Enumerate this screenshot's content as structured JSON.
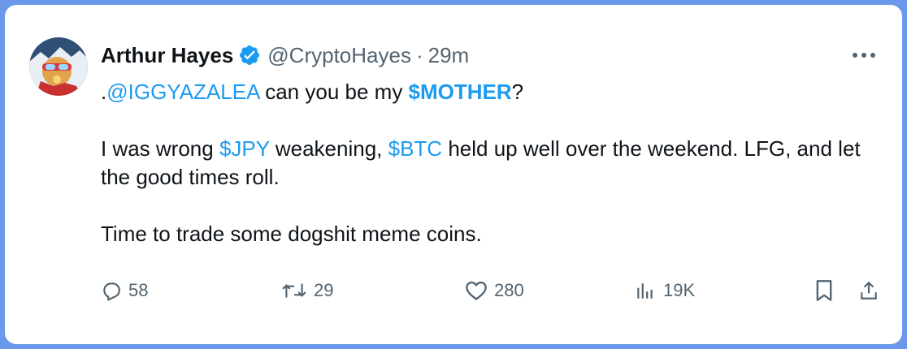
{
  "author": {
    "name": "Arthur Hayes",
    "handle": "@CryptoHayes",
    "separator": "·",
    "time": "29m"
  },
  "tweet": {
    "line1": {
      "prefix": ".",
      "mention": "@IGGYAZALEA",
      "mid": " can you be my ",
      "cashtag": "$MOTHER",
      "suffix": "?"
    },
    "line2": {
      "t1": "I was wrong ",
      "cashtag1": "$JPY",
      "t2": " weakening, ",
      "cashtag2": "$BTC",
      "t3": " held up well over the weekend. LFG, and let the good times roll."
    },
    "line3": "Time to trade some dogshit meme coins."
  },
  "actions": {
    "replies": "58",
    "reposts": "29",
    "likes": "280",
    "views": "19K"
  },
  "icons": [
    "verified-badge-icon",
    "more-icon",
    "reply-icon",
    "repost-icon",
    "like-icon",
    "views-icon",
    "bookmark-icon",
    "share-icon"
  ],
  "colors": {
    "background": "#6b98ea",
    "link": "#1d9bf0",
    "text": "#0f1419",
    "secondary": "#536471"
  }
}
